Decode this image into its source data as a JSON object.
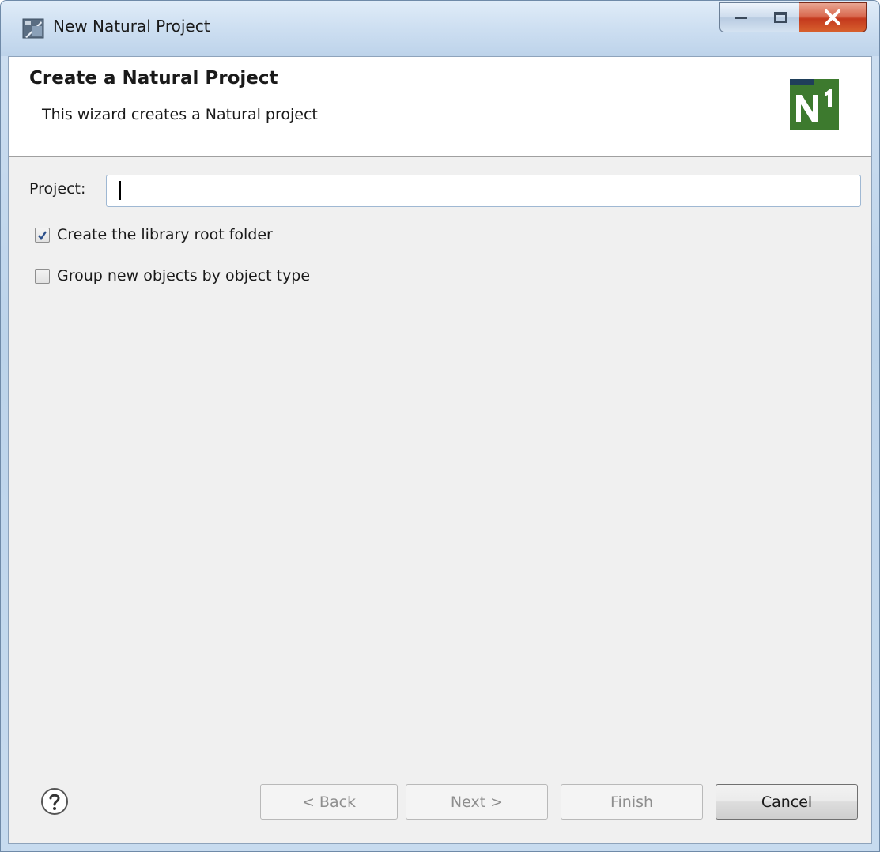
{
  "window": {
    "title": "New Natural Project"
  },
  "header": {
    "title": "Create a Natural Project",
    "description": "This wizard creates a Natural project",
    "logo_icon": "natural-n1-logo"
  },
  "form": {
    "project_label": "Project:",
    "project_value": "",
    "create_root_label": "Create the library root folder",
    "create_root_checked": true,
    "group_label": "Group new objects by object type",
    "group_checked": false
  },
  "buttons": {
    "back": "< Back",
    "next": "Next >",
    "finish": "Finish",
    "cancel": "Cancel"
  },
  "colors": {
    "logo_green": "#3d7a2e",
    "close_red": "#c4391d"
  }
}
